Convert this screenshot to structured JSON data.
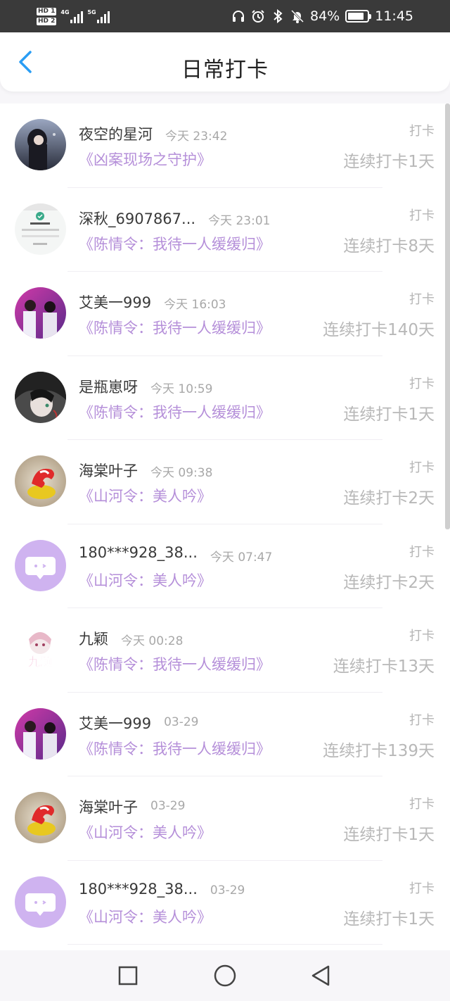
{
  "status_bar": {
    "hd1": "HD 1",
    "hd2": "HD 2",
    "net1": "4G",
    "net2": "5G",
    "battery_text": "84%",
    "battery_level": 0.84,
    "time": "11:45",
    "icons": [
      "headphones-icon",
      "alarm-icon",
      "bluetooth-icon",
      "bell-off-icon"
    ]
  },
  "header": {
    "title": "日常打卡",
    "back_icon": "chevron-left-icon",
    "accent": "#2a9df4"
  },
  "colors": {
    "book": "#b58fd9",
    "time": "#a8a8a8",
    "streak": "#b8b8b8",
    "name": "#3a3a3a"
  },
  "entries": [
    {
      "name": "夜空的星河",
      "time": "今天 23:42",
      "book": "《凶案现场之守护》",
      "checkin": "打卡",
      "streak": "连续打卡1天",
      "avatar": "dark-night"
    },
    {
      "name": "深秋_6907867...",
      "time": "今天 23:01",
      "book": "《陈情令：我待一人缓缓归》",
      "checkin": "打卡",
      "streak": "连续打卡8天",
      "avatar": "screenshot"
    },
    {
      "name": "艾美一999",
      "time": "今天 16:03",
      "book": "《陈情令：我待一人缓缓归》",
      "checkin": "打卡",
      "streak": "连续打卡140天",
      "avatar": "duo"
    },
    {
      "name": "是瓶崽呀",
      "time": "今天 10:59",
      "book": "《陈情令：我待一人缓缓归》",
      "checkin": "打卡",
      "streak": "连续打卡1天",
      "avatar": "anime-dark"
    },
    {
      "name": "海棠叶子",
      "time": "今天 09:38",
      "book": "《山河令：美人吟》",
      "checkin": "打卡",
      "streak": "连续打卡2天",
      "avatar": "red-toy"
    },
    {
      "name": "180***928_38...",
      "time": "今天 07:47",
      "book": "《山河令：美人吟》",
      "checkin": "打卡",
      "streak": "连续打卡2天",
      "avatar": "default"
    },
    {
      "name": "九颖",
      "time": "今天 00:28",
      "book": "《陈情令：我待一人缓缓归》",
      "checkin": "打卡",
      "streak": "连续打卡13天",
      "avatar": "chibi"
    },
    {
      "name": "艾美一999",
      "time": "03-29",
      "book": "《陈情令：我待一人缓缓归》",
      "checkin": "打卡",
      "streak": "连续打卡139天",
      "avatar": "duo"
    },
    {
      "name": "海棠叶子",
      "time": "03-29",
      "book": "《山河令：美人吟》",
      "checkin": "打卡",
      "streak": "连续打卡1天",
      "avatar": "red-toy"
    },
    {
      "name": "180***928_38...",
      "time": "03-29",
      "book": "《山河令：美人吟》",
      "checkin": "打卡",
      "streak": "连续打卡1天",
      "avatar": "default"
    }
  ],
  "navbar": {
    "icons": [
      "square-icon",
      "circle-icon",
      "triangle-back-icon"
    ]
  }
}
